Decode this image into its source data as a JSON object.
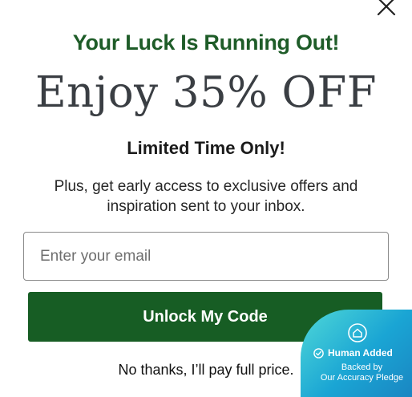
{
  "popup": {
    "headline": "Your Luck Is Running Out!",
    "offer": "Enjoy 35% OFF",
    "limited": "Limited Time Only!",
    "subtext": "Plus, get early access to exclusive offers and inspiration sent to your inbox.",
    "email_placeholder": "Enter your email",
    "email_value": "",
    "cta_label": "Unlock My Code",
    "decline_label": "No thanks, I’ll pay full price.",
    "close_icon": "close-icon"
  },
  "badge": {
    "title": "Human Added",
    "line1": "Backed by",
    "line2": "Our Accuracy Pledge",
    "icons": [
      "home-icon",
      "check-circle-icon"
    ]
  },
  "colors": {
    "headline": "#1e5c28",
    "cta_background": "#175d24",
    "badge_gradient_start": "#4fd8d8",
    "badge_gradient_end": "#1a86c2"
  }
}
